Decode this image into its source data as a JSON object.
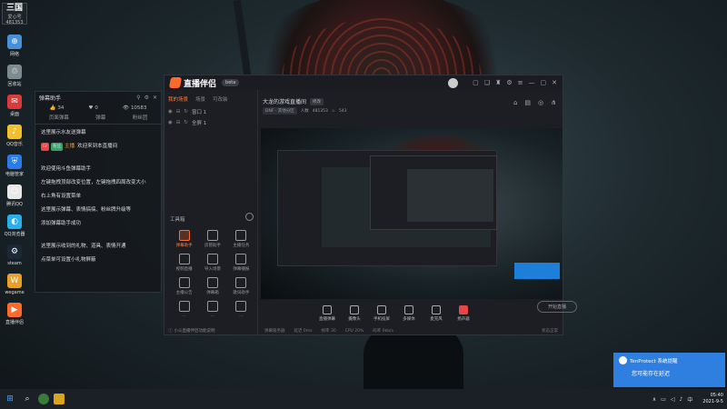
{
  "desktop": {
    "badge": {
      "top": "三国",
      "sub": "爱心号",
      "num": "481353"
    },
    "icons": [
      {
        "label": "网络",
        "color": "#4a90d9",
        "glyph": "⊕"
      },
      {
        "label": "回收站",
        "color": "#7d8a90",
        "glyph": "♲"
      },
      {
        "label": "桌面",
        "color": "#d93a3a",
        "glyph": "✉"
      },
      {
        "label": "QQ音乐",
        "color": "#f0c030",
        "glyph": "♪"
      },
      {
        "label": "电脑管家",
        "color": "#2a7be8",
        "glyph": "⛨"
      },
      {
        "label": "腾讯QQ",
        "color": "#e8e8e8",
        "glyph": "☺"
      },
      {
        "label": "QQ浏览器",
        "color": "#2ab0e8",
        "glyph": "◐"
      },
      {
        "label": "steam",
        "color": "#1b2838",
        "glyph": "⚙"
      },
      {
        "label": "wegame",
        "color": "#e8a02a",
        "glyph": "W"
      },
      {
        "label": "直播伴侣",
        "color": "#ff6a2b",
        "glyph": "▶"
      }
    ]
  },
  "danmu": {
    "title": "弹幕助手",
    "stats": [
      {
        "icon": "👍",
        "value": "34"
      },
      {
        "icon": "♥",
        "value": "0"
      },
      {
        "icon": "👁",
        "value": "10583"
      }
    ],
    "tabs": [
      "页面弹幕",
      "弹幕",
      "粉丝团"
    ],
    "messages": [
      {
        "text": "这里展示水友送弹幕"
      },
      {
        "tag1": "LV",
        "tag2": "粉丝",
        "name": "主播",
        "text": "欢迎来到本直播间"
      },
      {
        "text": "欢迎使用斗鱼弹幕助手"
      },
      {
        "text": "左键拖拽顶部改变位置，左键拖拽四周改变大小"
      },
      {
        "text": "右上角有设置菜单"
      },
      {
        "text": "这里展示弹幕、表情搞搞、粉丝牌升级等"
      },
      {
        "text": "添加弹幕助手成功"
      },
      {
        "text": "这里展示收到的礼物、道具、表情开通"
      },
      {
        "text": "点菜单可设置小礼物屏蔽"
      }
    ]
  },
  "app": {
    "name": "直播伴侣",
    "version": "beta",
    "scene_tabs": [
      "我的场景",
      "场景",
      "可改装"
    ],
    "scenes": [
      {
        "name": "窗口 1"
      },
      {
        "name": "全屏 1"
      }
    ],
    "tools_title": "工具箱",
    "tools": [
      {
        "label": "弹幕助手",
        "hot": true
      },
      {
        "label": "房管助手",
        "hot": false
      },
      {
        "label": "主播任务",
        "hot": false
      },
      {
        "label": "视频直播",
        "hot": false
      },
      {
        "label": "导入场景",
        "hot": false
      },
      {
        "label": "弹幕播报",
        "hot": false
      },
      {
        "label": "主播公告",
        "hot": false
      },
      {
        "label": "弹幕箱",
        "hot": false
      },
      {
        "label": "歌词助手",
        "hot": false
      },
      {
        "label": "…",
        "hot": false
      },
      {
        "label": "…",
        "hot": false
      },
      {
        "label": "…",
        "hot": false
      }
    ],
    "footer": "小斗直播伴侣功能说明",
    "room_title": "大龙的游戏直播间",
    "edit_label": "修改",
    "meta": [
      "DNF · 其他分区",
      "人数",
      "481353",
      "543"
    ],
    "controls": [
      {
        "label": "直播弹幕"
      },
      {
        "label": "摄像头"
      },
      {
        "label": "手机投屏"
      },
      {
        "label": "多媒体"
      },
      {
        "label": "麦克风"
      },
      {
        "label": "扬声器",
        "red": true
      }
    ],
    "go_live": "开始直播",
    "status": [
      "弹幕服务器",
      "延迟 0ms",
      "帧率 30",
      "CPU 20%",
      "码率 0kb/s"
    ],
    "status_right": "状态正常"
  },
  "toast": {
    "app": "TenProtect 系统提醒",
    "body": "您可能存在延迟"
  },
  "taskbar": {
    "time": "05:40",
    "date": "2021-9-5",
    "lang": "中"
  }
}
